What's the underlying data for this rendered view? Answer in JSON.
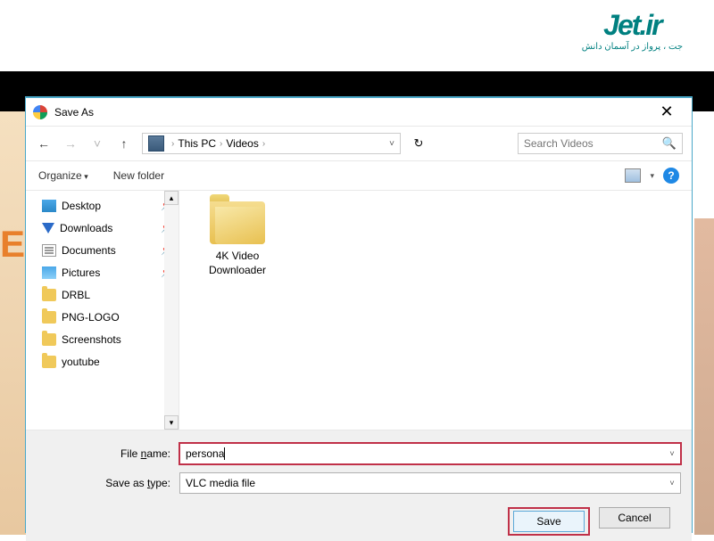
{
  "logo": {
    "main": "Jet.ir",
    "sub": "جت ، پرواز در آسمان دانش"
  },
  "dialog": {
    "title": "Save As",
    "nav": {
      "breadcrumb": [
        "This PC",
        "Videos"
      ],
      "search_placeholder": "Search Videos"
    },
    "toolbar": {
      "organize": "Organize",
      "new_folder": "New folder"
    },
    "sidebar": {
      "items": [
        {
          "label": "Desktop",
          "icon": "desktop",
          "pinned": true
        },
        {
          "label": "Downloads",
          "icon": "down",
          "pinned": true
        },
        {
          "label": "Documents",
          "icon": "doc",
          "pinned": true
        },
        {
          "label": "Pictures",
          "icon": "pic",
          "pinned": true
        },
        {
          "label": "DRBL",
          "icon": "folder",
          "pinned": false
        },
        {
          "label": "PNG-LOGO",
          "icon": "folder",
          "pinned": false
        },
        {
          "label": "Screenshots",
          "icon": "folder",
          "pinned": false
        },
        {
          "label": "youtube",
          "icon": "folder",
          "pinned": false
        }
      ]
    },
    "main": {
      "folders": [
        {
          "name": "4K Video Downloader"
        }
      ]
    },
    "fields": {
      "filename_label_pre": "File ",
      "filename_label_ul": "n",
      "filename_label_post": "ame:",
      "filename_value": "persona",
      "type_label_pre": "Save as ",
      "type_label_ul": "t",
      "type_label_post": "ype:",
      "type_value": "VLC media file"
    },
    "buttons": {
      "save": "Save",
      "cancel": "Cancel"
    }
  }
}
